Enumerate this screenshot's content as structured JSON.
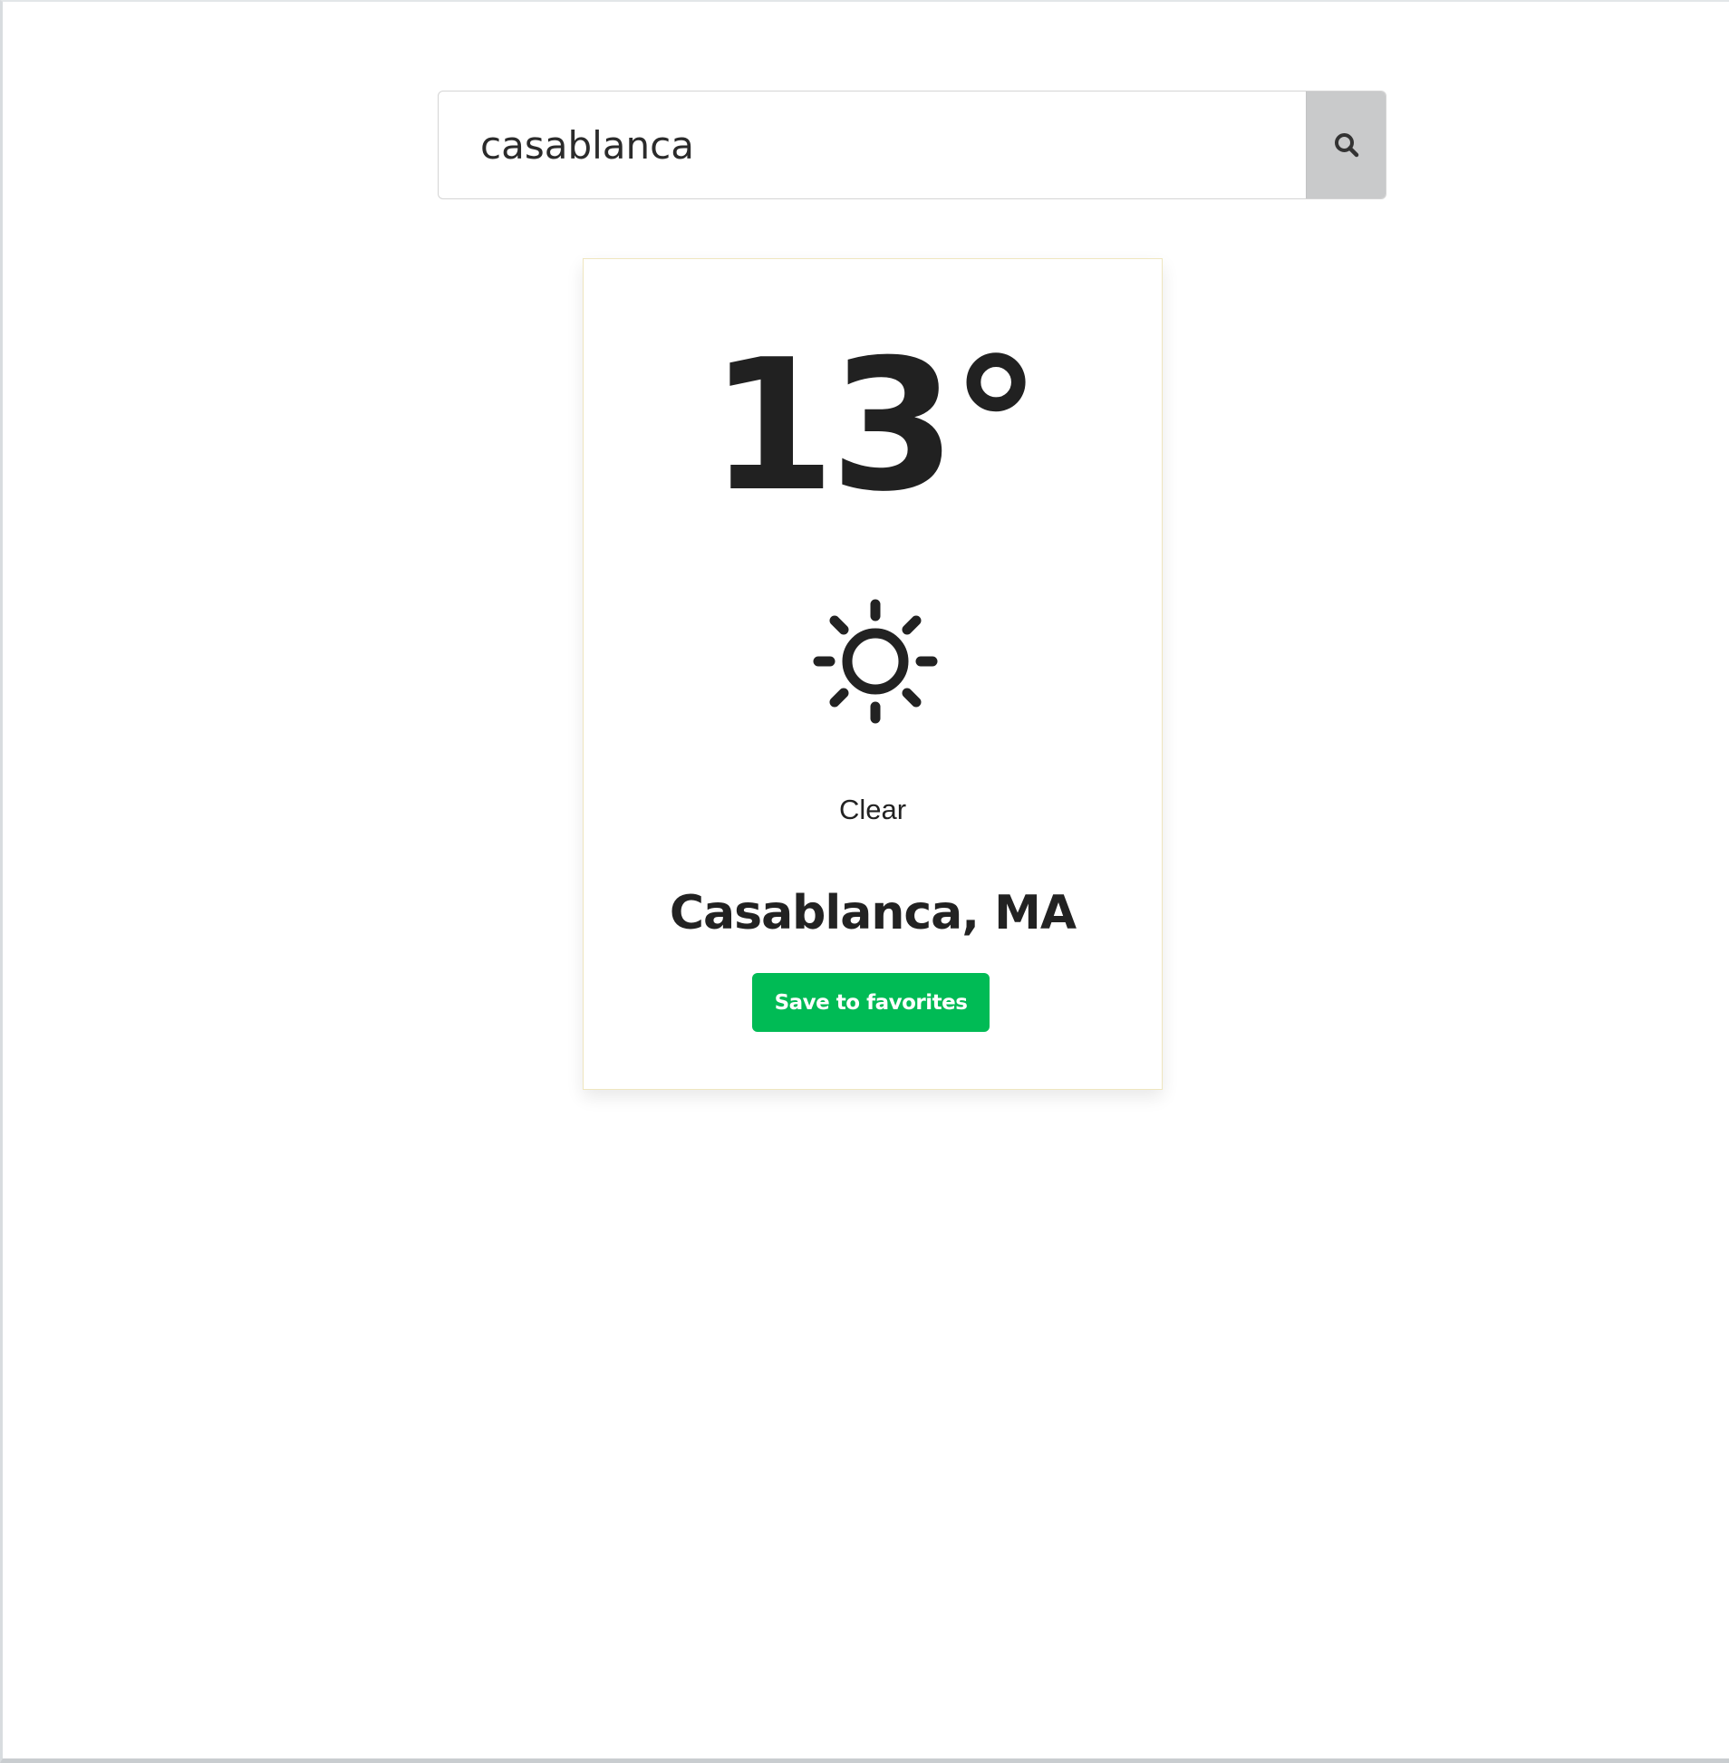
{
  "search": {
    "value": "casablanca",
    "icon": "search-icon"
  },
  "weather": {
    "temperature": "13°",
    "icon": "sun-icon",
    "condition": "Clear",
    "location": "Casablanca, MA",
    "save_label": "Save to favorites"
  },
  "colors": {
    "accent": "#00bb55",
    "text": "#222222",
    "search_button_bg": "#c9cacb",
    "card_border": "#efe6bf"
  }
}
